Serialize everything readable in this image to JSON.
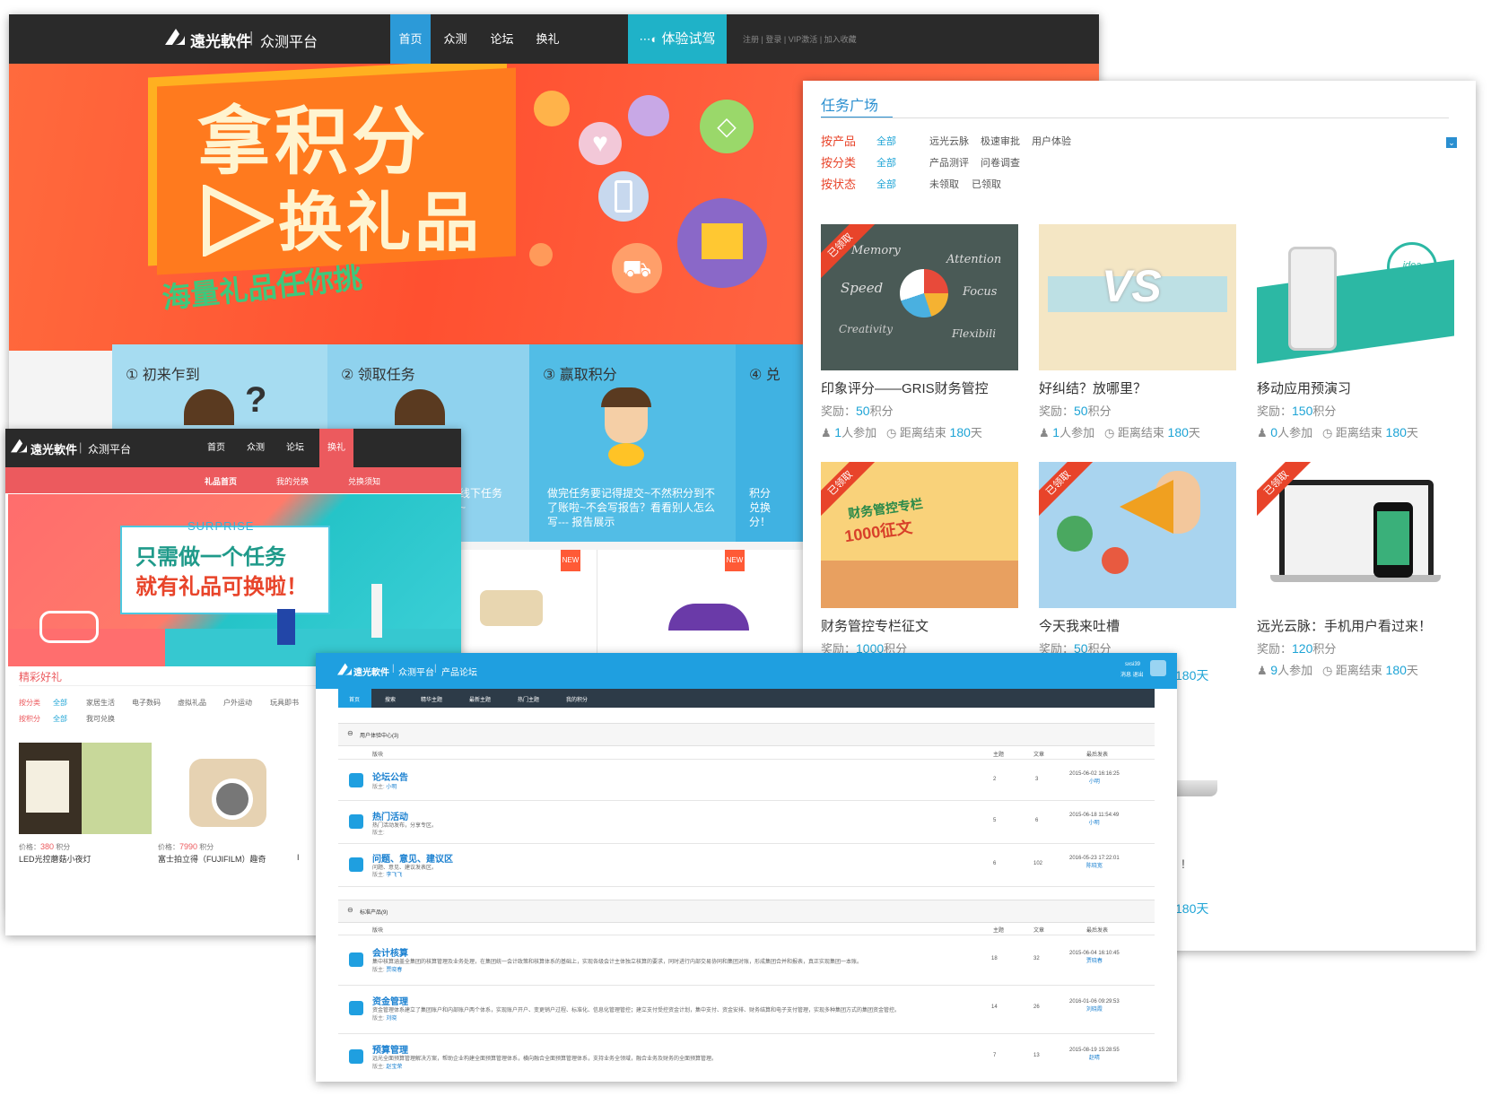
{
  "brand": {
    "logo_text": "遠光軟件",
    "divider": "|",
    "platform": "众测平台",
    "forum": "产品论坛"
  },
  "winA": {
    "nav": [
      "首页",
      "众测",
      "论坛",
      "换礼"
    ],
    "trial_button": "体验试驾",
    "top_links": [
      "注册",
      "|",
      "登录",
      "|",
      "VIP激活",
      "|",
      "加入收藏"
    ],
    "banner": {
      "line1": "拿积分",
      "line2": "换礼品",
      "line3": "海量礼品任你挑"
    },
    "steps": [
      {
        "title": "① 初来乍到",
        "desc": ""
      },
      {
        "title": "② 领取任务",
        "desc": "和线下任务\n诫~"
      },
      {
        "title": "③ 赢取积分",
        "desc": "做完任务要记得提交~不然积分到不\n了账啦~不会写报告？看看别人怎么\n写--- 报告展示"
      },
      {
        "title": "④ 兑",
        "desc": "积分\n兑换\n分！"
      }
    ],
    "badges": [
      "NEW",
      "NEW"
    ]
  },
  "winB": {
    "title": "任务广场",
    "filters": [
      {
        "label": "按产品",
        "all": "全部",
        "options": [
          "远光云脉",
          "极速审批",
          "用户体验"
        ]
      },
      {
        "label": "按分类",
        "all": "全部",
        "options": [
          "产品测评",
          "问卷调查"
        ]
      },
      {
        "label": "按状态",
        "all": "全部",
        "options": [
          "未领取",
          "已领取"
        ]
      }
    ],
    "ribbon": "已领取",
    "reward_label": "奖励：",
    "points_unit": "积分",
    "people_suffix": "人参加",
    "remain_prefix": "距离结束",
    "day_unit": "天",
    "cards": [
      {
        "title": "印象评分——GRIS财务管控",
        "points": "50",
        "people": "1",
        "days": "180",
        "claimed": true,
        "art": "chalk"
      },
      {
        "title": "好纠结？放哪里？",
        "points": "50",
        "people": "1",
        "days": "180",
        "claimed": false,
        "art": "vs"
      },
      {
        "title": "移动应用预演习",
        "points": "150",
        "people": "0",
        "days": "180",
        "claimed": false,
        "art": "phone"
      },
      {
        "title": "财务管控专栏征文",
        "points": "1000",
        "people": "",
        "days": "",
        "claimed": true,
        "art": "essay"
      },
      {
        "title": "今天我来吐槽",
        "points": "50",
        "people": "",
        "days": "",
        "claimed": true,
        "art": "rant"
      },
      {
        "title": "远光云脉：手机用户看过来！",
        "points": "120",
        "people": "9",
        "days": "180",
        "claimed": true,
        "art": "devices"
      }
    ],
    "art_text": {
      "memory": "Memory",
      "attention": "Attention",
      "speed": "Speed",
      "focus": "Focus",
      "creativity": "Creativity",
      "flexibility": "Flexibili",
      "vs": "VS",
      "idea": "idea",
      "essay_top": "财务管控专栏",
      "essay_bottom": "1000征文"
    },
    "peek_texts": [
      "180天",
      "!",
      "180天"
    ]
  },
  "winC": {
    "nav": [
      "首页",
      "众测",
      "论坛",
      "换礼"
    ],
    "subnav": [
      "礼品首页",
      "我的兑换",
      "兑换须知"
    ],
    "banner": {
      "surprise": "SURPRISE",
      "line1": "只需做一个任务",
      "line2": "就有礼品可换啦！"
    },
    "section_title": "精彩好礼",
    "filters": [
      {
        "label": "按分类",
        "all": "全部",
        "options": [
          "家居生活",
          "电子数码",
          "虚拟礼品",
          "户外运动",
          "玩具即书"
        ]
      },
      {
        "label": "按积分",
        "all": "全部",
        "options": [
          "我可兑换"
        ]
      }
    ],
    "price_label": "价格：",
    "price_unit": "积分",
    "products": [
      {
        "name": "LED光控蘑菇小夜灯",
        "price": "380"
      },
      {
        "name": "富士拍立得（FUJIFILM）趣奇",
        "price": "7990"
      }
    ],
    "edge_char": "I"
  },
  "winD": {
    "user": {
      "name": "sxsi39",
      "links": "消息 退出"
    },
    "nav": [
      "首页",
      "搜索",
      "精华主题",
      "最新主题",
      "热门主题",
      "我的积分"
    ],
    "columns": [
      "版块",
      "主题",
      "文章",
      "最后发表"
    ],
    "categories": [
      {
        "title": "用户体验中心(3)",
        "forums": [
          {
            "name": "论坛公告",
            "desc": "",
            "mod_label": "版主:",
            "mod": "小明",
            "topics": "2",
            "posts": "3",
            "date": "2015-06-02 16:16:25",
            "by": "小明"
          },
          {
            "name": "热门活动",
            "desc": "热门活动发布，分享专区。",
            "mod_label": "版主:",
            "mod": "",
            "topics": "5",
            "posts": "6",
            "date": "2015-06-18 11:54:49",
            "by": "小明"
          },
          {
            "name": "问题、意见、建议区",
            "desc": "问题、意见、建议发表区。",
            "mod_label": "版主:",
            "mod": "李飞飞",
            "topics": "6",
            "posts": "102",
            "date": "2016-05-23 17:22:01",
            "by": "陈晓宽"
          }
        ]
      },
      {
        "title": "标准产品(9)",
        "forums": [
          {
            "name": "会计核算",
            "desc": "集中核算涵盖全集团的核算管理及业务处理，在集团统一会计政策和核算体系的基础上，实现各级会计主体独立核算的要求，同时进行内部交易协同和集团对账，形成集团合并和报表，真正实现集团一本账。",
            "mod_label": "版主:",
            "mod": "贾晓春",
            "topics": "18",
            "posts": "32",
            "date": "2015-06-04 16:10:45",
            "by": "贾晓春"
          },
          {
            "name": "资金管理",
            "desc": "资金管理体系建立了集团账户和内部账户两个体系，实现账户开户、变更销户过程、标准化、信息化管理管控；建立支付受控资金计划，集中支付、资金安排、财务结算和电子支付管理，实现多种集团方式的集团资金管控。",
            "mod_label": "版主:",
            "mod": "刘晓",
            "topics": "14",
            "posts": "26",
            "date": "2016-01-06 09:29:53",
            "by": "刘晓霞"
          },
          {
            "name": "预算管理",
            "desc": "远光全面预算管理解决方案，帮助企业构建全面预算管理体系，横向融合全面预算管理体系，支持业务全领域，融合业务及财务的全面预算管理。",
            "mod_label": "版主:",
            "mod": "赵宝荣",
            "topics": "7",
            "posts": "13",
            "date": "2015-08-19 15:28:55",
            "by": "赵晴"
          }
        ]
      }
    ]
  },
  "colors": {
    "dark": "#2a2a2a",
    "accent_blue": "#2c9ad8",
    "trial_teal": "#1fb2c8",
    "brand_red": "#ec5a5e",
    "forum_blue": "#1f9fe0",
    "orange": "#ff5a36",
    "link_blue": "#1ea4d6"
  }
}
